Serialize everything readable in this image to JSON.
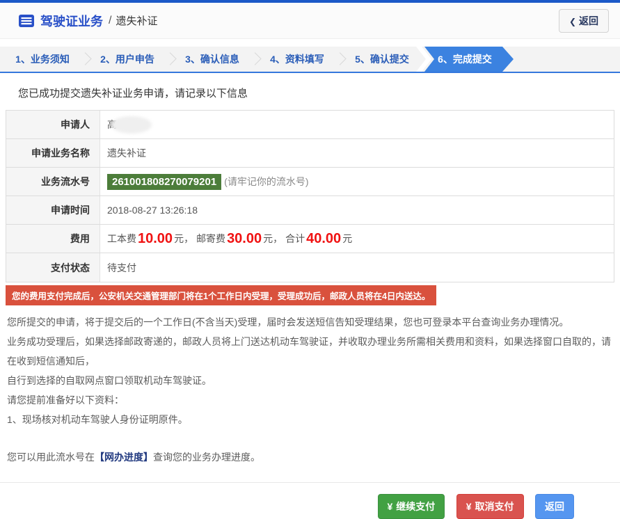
{
  "header": {
    "title": "驾驶证业务",
    "crumb_separator": "/",
    "subtitle": "遗失补证",
    "back_chevron": "❮",
    "back_label": "返回"
  },
  "steps": {
    "items": [
      {
        "label": "1、业务须知"
      },
      {
        "label": "2、用户申告"
      },
      {
        "label": "3、确认信息"
      },
      {
        "label": "4、资料填写"
      },
      {
        "label": "5、确认提交"
      },
      {
        "label": "6、完成提交"
      }
    ],
    "active_index": 5
  },
  "main": {
    "success_message": "您已成功提交遗失补证业务申请，请记录以下信息",
    "table": {
      "rows": [
        {
          "label": "申请人",
          "value": "高"
        },
        {
          "label": "申请业务名称",
          "value": "遗失补证"
        },
        {
          "label": "业务流水号",
          "serial": "261001808270079201",
          "note": "(请牢记你的流水号)"
        },
        {
          "label": "申请时间",
          "value": "2018-08-27 13:26:18"
        },
        {
          "label": "费用"
        },
        {
          "label": "支付状态",
          "value": "待支付"
        }
      ]
    },
    "fee": {
      "label1": "工本费",
      "amount1": "10.00",
      "unit1": "元",
      "comma1": "，",
      "label2": "邮寄费",
      "amount2": "30.00",
      "unit2": "元",
      "comma2": "，",
      "label3": "合计",
      "amount3": "40.00",
      "unit3": "元"
    },
    "warning": "您的费用支付完成后，公安机关交通管理部门将在1个工作日内受理，受理成功后，邮政人员将在4日内送达。",
    "paragraphs": [
      "您所提交的申请，将于提交后的一个工作日(不含当天)受理，届时会发送短信告知受理结果，您也可登录本平台查询业务办理情况。",
      "业务成功受理后，如果选择邮政寄递的，邮政人员将上门送达机动车驾驶证，并收取办理业务所需相关费用和资料，如果选择窗口自取的，请在收到短信通知后，",
      "自行到选择的自取网点窗口领取机动车驾驶证。",
      "请您提前准备好以下资料：",
      "1、现场核对机动车驾驶人身份证明原件。"
    ],
    "progress": {
      "prefix": "您可以用此流水号在",
      "link": "【网办进度】",
      "suffix": "查询您的业务办理进度。"
    }
  },
  "footer": {
    "yen": "¥",
    "continue_pay": "继续支付",
    "cancel_pay": "取消支付",
    "back": "返回"
  },
  "colors": {
    "accent_blue": "#3b82e0",
    "topbar_blue": "#1c59c8",
    "serial_green": "#4c7d3a",
    "warning_red": "#d9513d",
    "fee_red": "#f01212",
    "button_green": "#42a143",
    "button_red": "#d9534f",
    "button_blue": "#5596f0"
  }
}
